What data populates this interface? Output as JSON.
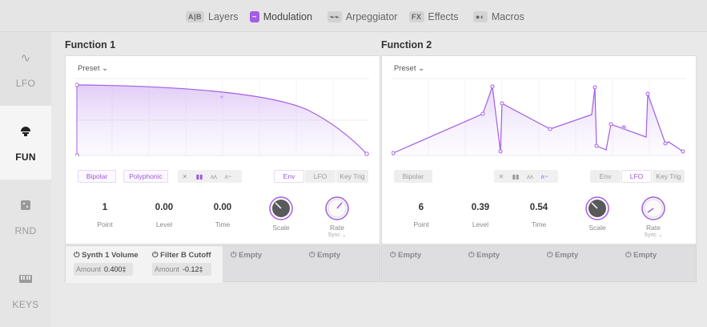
{
  "tabs": [
    {
      "icon": "A|B",
      "label": "Layers",
      "active": false
    },
    {
      "icon": "~",
      "label": "Modulation",
      "active": true
    },
    {
      "icon": "arp",
      "label": "Arpeggiator",
      "active": false
    },
    {
      "icon": "FX",
      "label": "Effects",
      "active": false
    },
    {
      "icon": "macros",
      "label": "Macros",
      "active": false
    }
  ],
  "sidebar": [
    {
      "label": "LFO",
      "icon": "sine-wave-icon"
    },
    {
      "label": "FUN",
      "icon": "function-icon",
      "active": true
    },
    {
      "label": "RND",
      "icon": "dice-icon"
    },
    {
      "label": "KEYS",
      "icon": "keyboard-icon"
    }
  ],
  "functions": [
    {
      "title": "Function 1",
      "preset": "Preset ⌄",
      "mode_buttons": [
        "Bipolar",
        "Polyphonic"
      ],
      "trigger_buttons": [
        "Env",
        "LFO",
        "Key Trig"
      ],
      "trigger_selected": "Env",
      "params": {
        "point": {
          "value": "1",
          "label": "Point"
        },
        "level": {
          "value": "0.00",
          "label": "Level"
        },
        "time": {
          "value": "0.00",
          "label": "Time"
        },
        "scale": {
          "label": "Scale"
        },
        "rate": {
          "label": "Rate",
          "sub": "Sync ⌄"
        }
      }
    },
    {
      "title": "Function 2",
      "preset": "Preset ⌄",
      "mode_buttons": [
        "Bipolar"
      ],
      "trigger_buttons": [
        "Env",
        "LFO",
        "Key Trig"
      ],
      "trigger_selected": "LFO",
      "params": {
        "point": {
          "value": "6",
          "label": "Point"
        },
        "level": {
          "value": "0.39",
          "label": "Level"
        },
        "time": {
          "value": "0.54",
          "label": "Time"
        },
        "scale": {
          "label": "Scale"
        },
        "rate": {
          "label": "Rate",
          "sub": "Sync ⌄"
        }
      }
    }
  ],
  "slots": [
    {
      "title": "Synth 1 Volume",
      "amount_label": "Amount",
      "amount": "0.400‡"
    },
    {
      "title": "Filter B Cutoff",
      "amount_label": "Amount",
      "amount": "-0.12‡"
    },
    {
      "title": "Empty"
    },
    {
      "title": "Empty"
    },
    {
      "title": "Empty"
    },
    {
      "title": "Empty"
    },
    {
      "title": "Empty"
    },
    {
      "title": "Empty"
    }
  ],
  "colors": {
    "accent": "#a35ee3",
    "background": "#e9e9ea",
    "panel": "#ffffff"
  }
}
